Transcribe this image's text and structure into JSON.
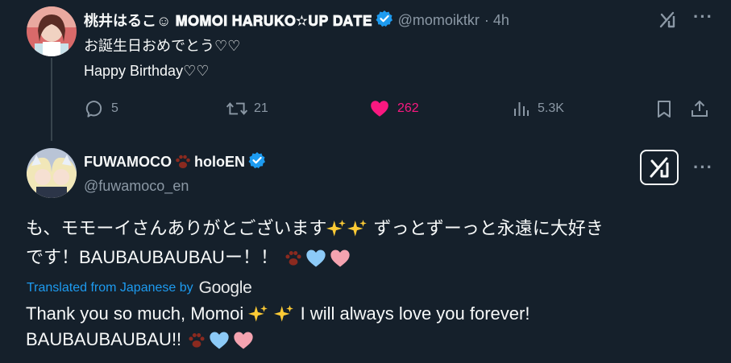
{
  "colors": {
    "background": "#15202b",
    "text_primary": "#f7f9f9",
    "text_secondary": "#8b98a5",
    "accent_blue": "#1d9bf0",
    "like_pink": "#f91880",
    "verified_blue": "#1d9bf0"
  },
  "tweet1": {
    "display_name": "桃井はるこ☺ 𝐌𝐎𝐌𝐎𝐈 𝐇𝐀𝐑𝐔𝐊𝐎✫𝐔𝐏 𝐃𝐀𝐓𝐄",
    "handle": "@momoiktkr",
    "time": "· 4h",
    "line1": "お誕生日おめでとう♡♡",
    "line2": "Happy Birthday♡♡",
    "replies": "5",
    "retweets": "21",
    "likes": "262",
    "views": "5.3K",
    "icons": [
      "reply-icon",
      "retweet-icon",
      "like-icon",
      "views-icon",
      "bookmark-icon",
      "share-icon",
      "grok-icon",
      "more-icon",
      "verified-icon"
    ]
  },
  "tweet2": {
    "display_name_part1": "FUWAMOCO",
    "display_name_part2": "holoEN",
    "handle": "@fuwamoco_en",
    "text_line1_a": "も、モモーイさんありがとございます",
    "text_line1_b": " ずっとずーっと永遠に大好き",
    "text_line2": "です！BAUBAUBAUBAUー！！",
    "translated_label": "Translated from Japanese by",
    "translator": "Google",
    "translation_line1_a": "Thank you so much, Momoi ",
    "translation_line1_b": " I will always love you forever!",
    "translation_line2": "BAUBAUBAUBAU!! ",
    "icons": [
      "paw-icon",
      "sparkles-icon",
      "blue-heart-icon",
      "pink-heart-icon",
      "grok-icon",
      "more-icon",
      "verified-icon"
    ]
  }
}
